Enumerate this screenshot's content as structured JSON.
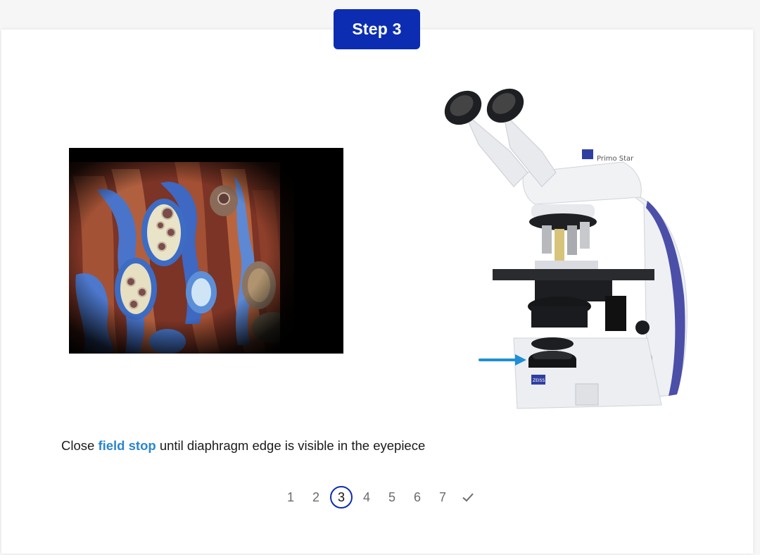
{
  "step_badge": "Step 3",
  "instruction": {
    "before": "Close ",
    "highlight": "field stop",
    "after": " until diaphragm edge is visible in the eyepiece"
  },
  "microscope": {
    "brand_label": "Primo Star",
    "logo_text": "ZEISS"
  },
  "pager": {
    "pages": [
      "1",
      "2",
      "3",
      "4",
      "5",
      "6",
      "7"
    ],
    "current": "3",
    "done_icon": "checkmark-icon"
  },
  "colors": {
    "accent_blue": "#0c2db2",
    "highlight_blue": "#2a86cf",
    "arrow_blue": "#1e8fd6"
  }
}
